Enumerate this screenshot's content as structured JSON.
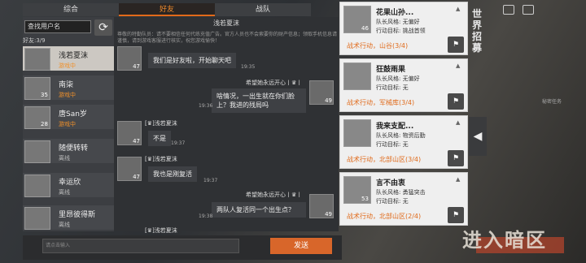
{
  "tabs": [
    {
      "label": "综合",
      "active": false
    },
    {
      "label": "好友",
      "active": true
    },
    {
      "label": "战队",
      "active": false
    }
  ],
  "contacts_panel": {
    "search_placeholder": "查找用户名",
    "refresh_icon": "refresh-icon",
    "friend_count": "好友:3/9",
    "contacts": [
      {
        "name": "浅若夏沫",
        "level": "",
        "status": "游戏中",
        "status_type": "online",
        "selected": true
      },
      {
        "name": "南柒",
        "level": "35",
        "status": "游戏中",
        "status_type": "online",
        "selected": false
      },
      {
        "name": "唐San岁",
        "level": "28",
        "status": "游戏中",
        "status_type": "online",
        "selected": false
      },
      {
        "name": "随便转转",
        "level": "",
        "status": "离线",
        "status_type": "offline",
        "selected": false
      },
      {
        "name": "幸运欣",
        "level": "",
        "status": "离线",
        "status_type": "offline",
        "selected": false
      },
      {
        "name": "里昂彼得斯",
        "level": "",
        "status": "离线",
        "status_type": "offline",
        "selected": false
      }
    ]
  },
  "chat": {
    "title": "浅若夏沫",
    "notice": "尊敬的特勤队员：请不要相信任何代练充值广告。官方人员也不会索要你的财产信息；领取手机信息请谨慎，请到游戏客服进行核实，祝您游戏愉快！",
    "messages": [
      {
        "side": "left",
        "sender": "",
        "text": "我们是好友啦，开始聊天吧",
        "time": "19:35",
        "level": "47"
      },
      {
        "side": "right",
        "sender": "希望她永远开心丨♛丨",
        "text": "啥情况，一出生就在你们脸上？我进的残局吗",
        "time": "19:36",
        "level": "49"
      },
      {
        "side": "left",
        "sender": "[♛]浅若夏沫",
        "text": "不是",
        "time": "19:37",
        "level": "47"
      },
      {
        "side": "left",
        "sender": "[♛]浅若夏沫",
        "text": "我也是刚复活",
        "time": "19:37",
        "level": "47"
      },
      {
        "side": "right",
        "sender": "希望她永远开心丨♛丨",
        "text": "两队人复活同一个出生点？",
        "time": "19:38",
        "level": "49"
      },
      {
        "side": "left",
        "sender": "[♛]浅若夏沫",
        "text": "",
        "time": "",
        "level": ""
      }
    ],
    "input_placeholder": "请点击输入",
    "send_label": "发送"
  },
  "recruit_title": "世界招募",
  "recruit_cards": [
    {
      "name": "花果山孙...",
      "level": "46",
      "style": "队长风格: 无偏好",
      "goal": "行动目标: 挑战首领",
      "action": "战术行动，山谷(3/4)",
      "join_icon": "join-team-icon"
    },
    {
      "name": "狂鼓雨果",
      "level": "",
      "style": "队长风格: 无偏好",
      "goal": "行动目标: 无",
      "action": "战术行动，军械库(3/4)",
      "join_icon": "join-team-icon"
    },
    {
      "name": "我来支配...",
      "level": "",
      "style": "队长风格: 物资后勤",
      "goal": "行动目标: 无",
      "action": "战术行动，北部山区(3/4)",
      "join_icon": "join-team-icon"
    },
    {
      "name": "言不由衷",
      "level": "53",
      "style": "队长风格: 勇猛突击",
      "goal": "行动目标: 无",
      "action": "战术行动，北部山区(2/4)",
      "join_icon": "join-team-icon"
    }
  ],
  "background_text": "进入暗区",
  "collapse_icon": "triangle-left-icon",
  "side_label": "秘密任务"
}
